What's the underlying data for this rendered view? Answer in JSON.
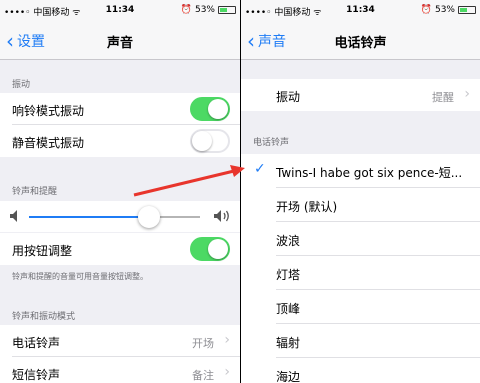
{
  "status": {
    "carrier": "••••◦ 中国移动 ᯤ",
    "time": "11:34",
    "battery": "53%",
    "battery_level": 0.53,
    "alarm_icon": "alarm-icon"
  },
  "left": {
    "nav": {
      "back_label": "设置",
      "title": "声音"
    },
    "section_vibrate": "振动",
    "ring_vibrate": {
      "label": "响铃模式振动",
      "on": true
    },
    "silent_vibrate": {
      "label": "静音模式振动",
      "on": false
    },
    "section_ringer": "铃声和提醒",
    "volume_level": 0.7,
    "adjust_buttons": {
      "label": "用按钮调整",
      "on": true
    },
    "ringer_footnote": "铃声和提醒的音量可用音量按钮调整。",
    "section_patterns": "铃声和振动模式",
    "ringtone": {
      "label": "电话铃声",
      "value": "开场"
    },
    "text_tone": {
      "label": "短信铃声",
      "value": "备注"
    }
  },
  "right": {
    "nav": {
      "back_label": "声音",
      "title": "电话铃声"
    },
    "vibration": {
      "label": "振动",
      "value": "提醒"
    },
    "section_ringtone": "电话铃声",
    "ringtones": [
      {
        "label": "Twins-I habe got six pence-短...",
        "selected": true
      },
      {
        "label": "开场 (默认)"
      },
      {
        "label": "波浪"
      },
      {
        "label": "灯塔"
      },
      {
        "label": "顶峰"
      },
      {
        "label": "辐射"
      },
      {
        "label": "海边"
      }
    ]
  },
  "colors": {
    "accent": "#1f7cf5",
    "toggle_on": "#4cd964",
    "annotation_arrow": "#e8352c"
  }
}
